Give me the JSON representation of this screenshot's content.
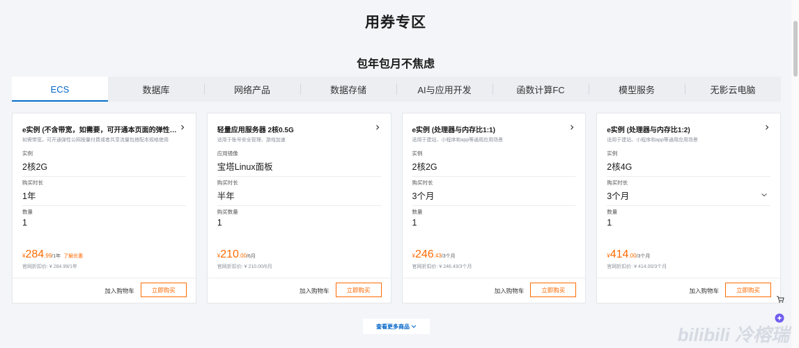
{
  "header": {
    "title": "用券专区",
    "subtitle": "包年包月不焦虑"
  },
  "tabs": [
    {
      "label": "ECS",
      "active": true
    },
    {
      "label": "数据库"
    },
    {
      "label": "网络产品"
    },
    {
      "label": "数据存储"
    },
    {
      "label": "AI与应用开发"
    },
    {
      "label": "函数计算FC"
    },
    {
      "label": "模型服务"
    },
    {
      "label": "无影云电脑"
    }
  ],
  "cards": [
    {
      "title": "e实例 (不含带宽，如需要，可开通本页面的弹性公...",
      "desc": "如需带宽，可开通弹性公网按量付费或者共享流量包搭配本规格使用",
      "f1_label": "实例",
      "f1_value": "2核2G",
      "f2_label": "购买时长",
      "f2_value": "1年",
      "f3_label": "数量",
      "f3_value": "1",
      "currency": "¥",
      "price_int": "284",
      "price_dec": ".99",
      "price_unit": "/1年",
      "promo": "了解优惠",
      "orig": "官网折扣价: ¥ 284.99/1年",
      "add_cart": "加入购物车",
      "buy": "立即购买"
    },
    {
      "title": "轻量应用服务器 2核0.5G",
      "desc": "适用于账号安全管理、游戏加速",
      "f1_label": "应用镜像",
      "f1_value": "宝塔Linux面板",
      "f2_label": "购买时长",
      "f2_value": "半年",
      "f3_label": "购买数量",
      "f3_value": "1",
      "currency": "¥",
      "price_int": "210",
      "price_dec": ".00",
      "price_unit": "/6月",
      "promo": "",
      "orig": "官网折扣价: ¥ 210.00/6月",
      "add_cart": "加入购物车",
      "buy": "立即购买"
    },
    {
      "title": "e实例 (处理器与内存比1:1)",
      "desc": "适用于建站、小程序和app等通用应用场景",
      "f1_label": "实例",
      "f1_value": "2核2G",
      "f2_label": "购买时长",
      "f2_value": "3个月",
      "f3_label": "数量",
      "f3_value": "1",
      "currency": "¥",
      "price_int": "246",
      "price_dec": ".43",
      "price_unit": "/3个月",
      "promo": "",
      "orig": "官网折扣价: ¥ 246.43/3个月",
      "add_cart": "加入购物车",
      "buy": "立即购买"
    },
    {
      "title": "e实例 (处理器与内存比1:2)",
      "desc": "适用于建站、小程序和app等通用应用场景",
      "f1_label": "实例",
      "f1_value": "2核4G",
      "f2_label": "购买时长",
      "f2_value": "3个月",
      "f3_label": "数量",
      "f3_value": "1",
      "currency": "¥",
      "price_int": "414",
      "price_dec": ".00",
      "price_unit": "/3个月",
      "promo": "",
      "orig": "官网折扣价: ¥ 414.00/3个月",
      "add_cart": "加入购物车",
      "buy": "立即购买"
    }
  ],
  "more_button": "查看更多商品",
  "watermark": "bilibili 冷榕瑞",
  "colors": {
    "accent": "#0064c8",
    "price": "#ff6a00"
  }
}
